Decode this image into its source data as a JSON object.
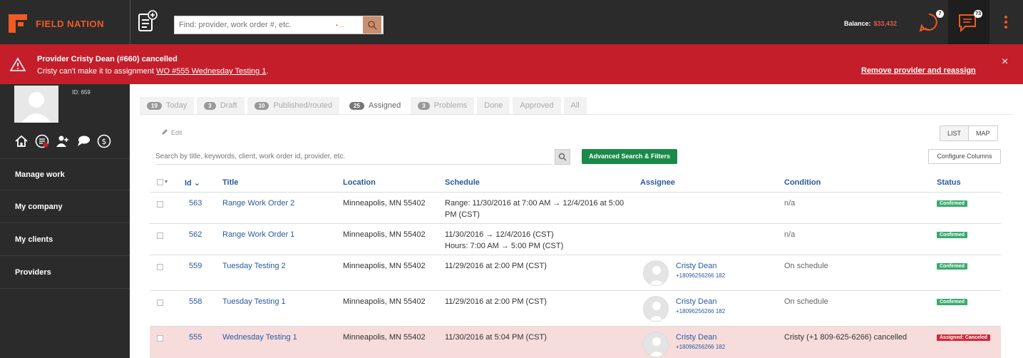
{
  "header": {
    "logo_text": "FIELD NATION",
    "search_placeholder": "Find: provider, work order #, etc.",
    "search_scope": "• ...",
    "balance_label": "Balance:",
    "balance_value": "$33,432",
    "notifications_count": "7",
    "messages_count": "73",
    "accent": "#f15a24"
  },
  "alert": {
    "title": "Provider Cristy Dean (#660) cancelled",
    "message_prefix": "Cristy can't make it to assignment ",
    "message_link": "WO #555 Wednesday Testing 1",
    "message_suffix": ".",
    "action": "Remove provider and reassign",
    "close": "×",
    "color": "#c41e2a"
  },
  "sidebar": {
    "user_id": "ID: 659",
    "icons": [
      "home-icon",
      "work-orders-icon",
      "team-icon",
      "chat-icon",
      "dollar-icon"
    ],
    "items": [
      {
        "label": "Manage work"
      },
      {
        "label": "My company"
      },
      {
        "label": "My clients"
      },
      {
        "label": "Providers"
      }
    ]
  },
  "tabs": [
    {
      "count": "19",
      "label": "Today"
    },
    {
      "count": "3",
      "label": "Draft"
    },
    {
      "count": "10",
      "label": "Published/routed"
    },
    {
      "count": "25",
      "label": "Assigned",
      "active": true
    },
    {
      "count": "3",
      "label": "Problems"
    },
    {
      "count": "",
      "label": "Done"
    },
    {
      "count": "",
      "label": "Approved"
    },
    {
      "count": "",
      "label": "All"
    }
  ],
  "toolbar": {
    "edit_label": "Edit",
    "view_list": "LIST",
    "view_map": "MAP",
    "filter_placeholder": "Search by title, keywords, client, work order id, provider, etc.",
    "advanced_label": "Advanced Search & Filters",
    "configure_label": "Configure Columns"
  },
  "table": {
    "columns": {
      "id": "Id",
      "title": "Title",
      "location": "Location",
      "schedule": "Schedule",
      "assignee": "Assignee",
      "condition": "Condition",
      "status": "Status"
    },
    "rows": [
      {
        "id": "563",
        "title": "Range Work Order 2",
        "location": "Minneapolis, MN 55402",
        "schedule_1": "Range: 11/30/2016 at 7:00 AM → 12/4/2016 at 5:00",
        "schedule_2": "PM (CST)",
        "assignee_name": "",
        "assignee_phone": "",
        "condition": "n/a",
        "status": "Confirmed"
      },
      {
        "id": "562",
        "title": "Range Work Order 1",
        "location": "Minneapolis, MN 55402",
        "schedule_1": "11/30/2016 → 12/4/2016  (CST)",
        "schedule_2": "Hours: 7:00 AM → 5:00 PM  (CST)",
        "assignee_name": "",
        "assignee_phone": "",
        "condition": "n/a",
        "status": "Confirmed"
      },
      {
        "id": "559",
        "title": "Tuesday Testing 2",
        "location": "Minneapolis, MN 55402",
        "schedule_1": "11/29/2016 at 2:00 PM  (CST)",
        "schedule_2": "",
        "assignee_name": "Cristy Dean",
        "assignee_phone": "+18096256266 182",
        "condition": "On schedule",
        "status": "Confirmed"
      },
      {
        "id": "558",
        "title": "Tuesday Testing 1",
        "location": "Minneapolis, MN 55402",
        "schedule_1": "11/29/2016 at 2:00 PM  (CST)",
        "schedule_2": "",
        "assignee_name": "Cristy Dean",
        "assignee_phone": "+18096256266 182",
        "condition": "On schedule",
        "status": "Confirmed"
      },
      {
        "id": "555",
        "title": "Wednesday Testing 1",
        "location": "Minneapolis, MN 55402",
        "schedule_1": "11/30/2016 at 5:04 PM  (CST)",
        "schedule_2": "",
        "assignee_name": "Cristy Dean",
        "assignee_phone": "+18096256266 182",
        "condition": "Cristy (+1 809-625-6266) cancelled",
        "status": "Assigned: Canceled"
      }
    ]
  }
}
